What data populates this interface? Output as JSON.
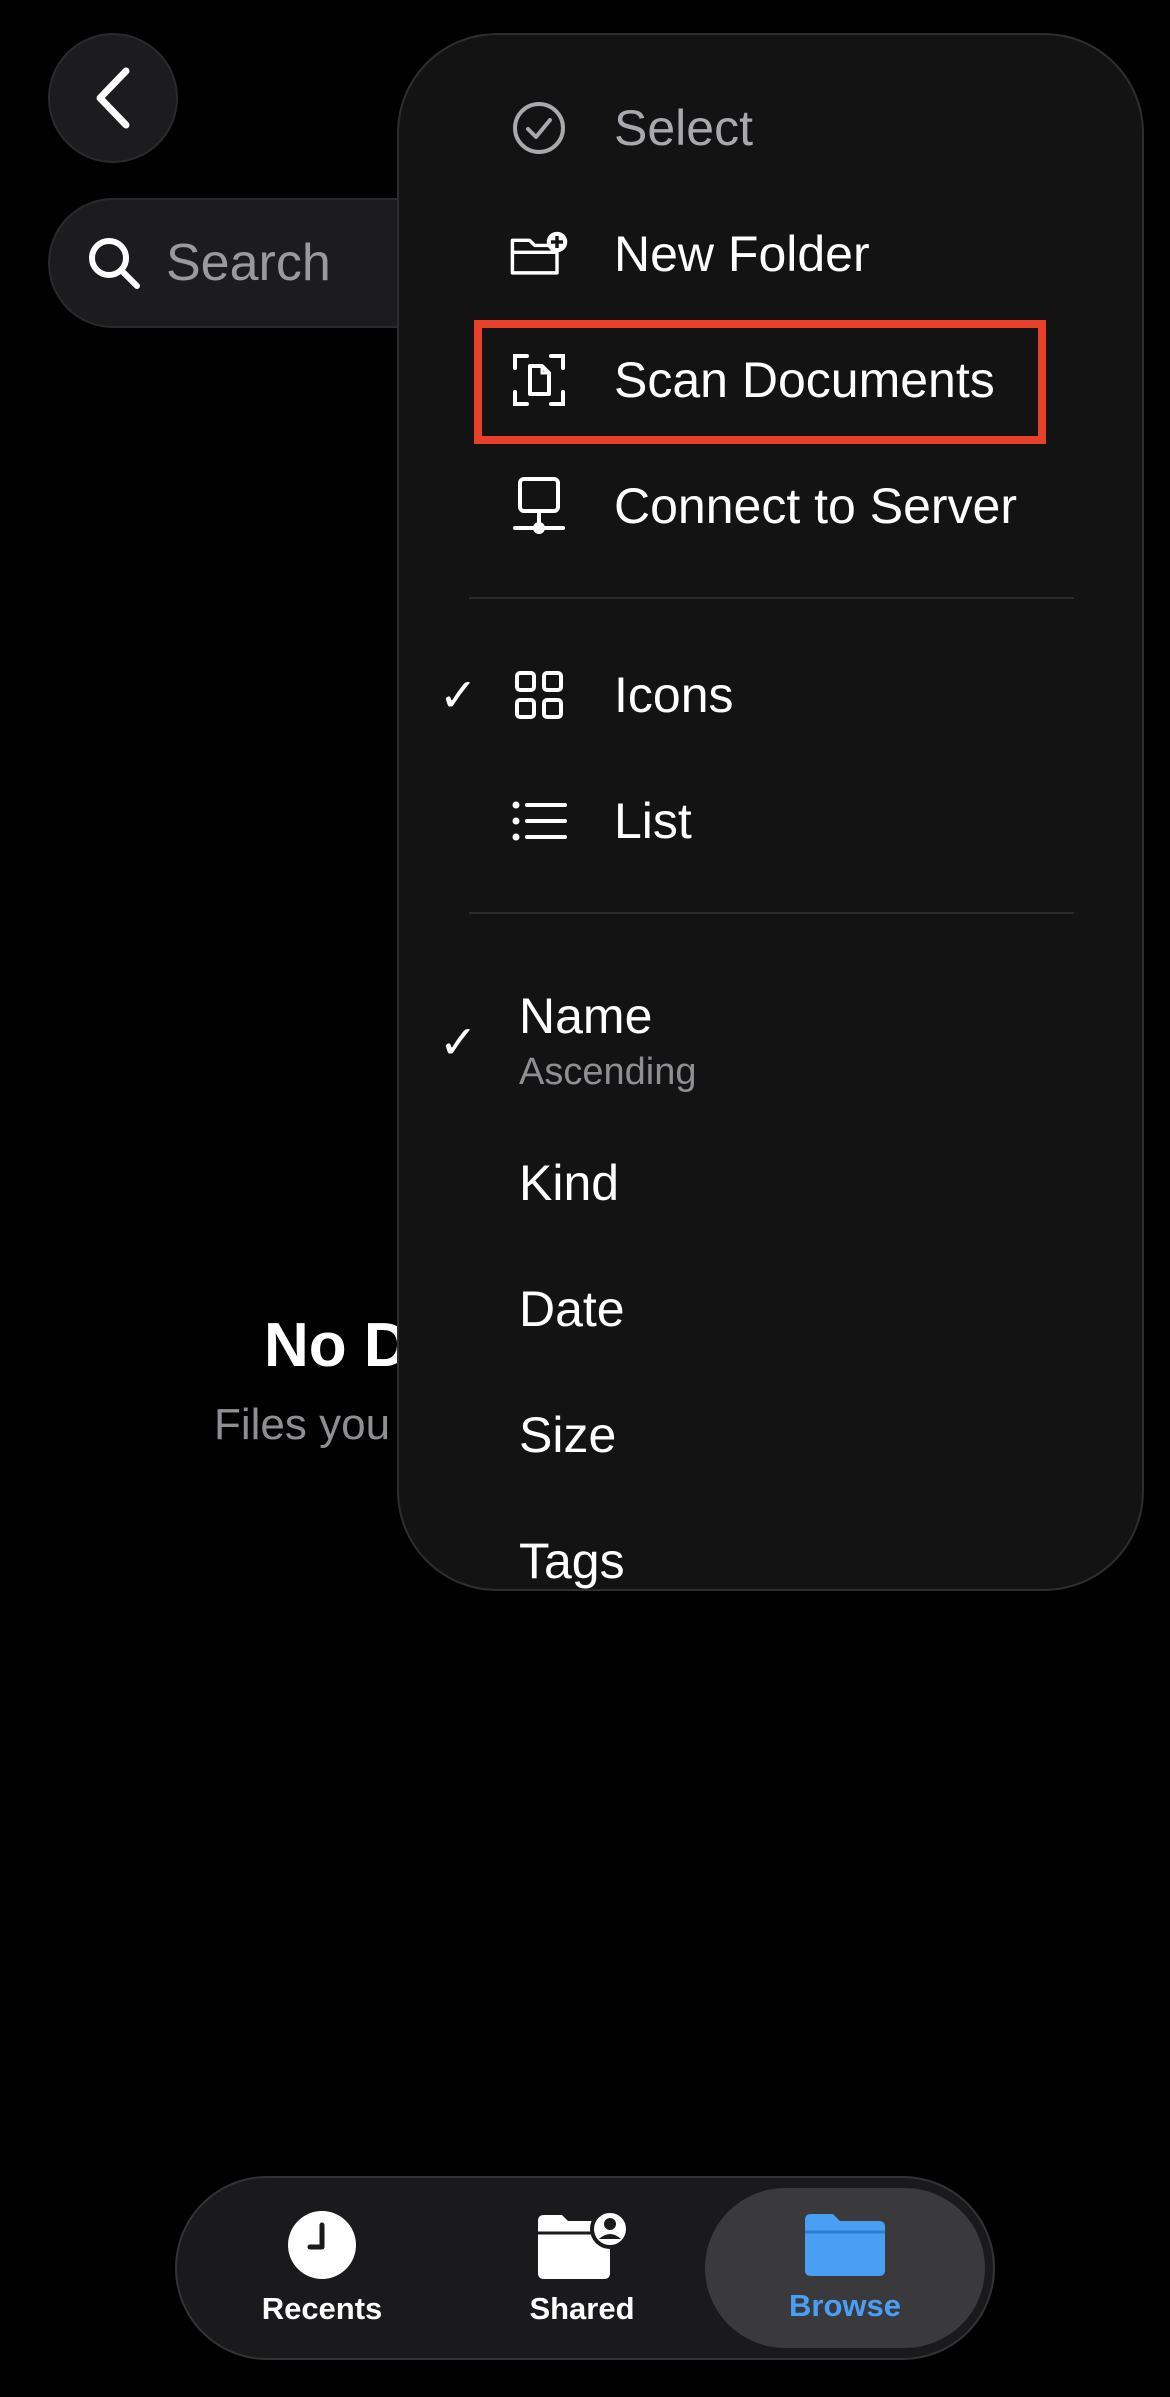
{
  "search": {
    "placeholder": "Search"
  },
  "empty_state": {
    "title": "No D",
    "subtitle": "Files you"
  },
  "menu": {
    "actions": [
      {
        "label": "Select"
      },
      {
        "label": "New Folder"
      },
      {
        "label": "Scan Documents",
        "highlighted": true
      },
      {
        "label": "Connect to Server"
      }
    ],
    "view_options": [
      {
        "label": "Icons",
        "checked": true
      },
      {
        "label": "List",
        "checked": false
      }
    ],
    "sort_options": [
      {
        "label": "Name",
        "sublabel": "Ascending",
        "checked": true
      },
      {
        "label": "Kind"
      },
      {
        "label": "Date"
      },
      {
        "label": "Size"
      },
      {
        "label": "Tags"
      }
    ]
  },
  "tabbar": {
    "tabs": [
      {
        "label": "Recents",
        "icon": "clock-icon"
      },
      {
        "label": "Shared",
        "icon": "shared-folder-icon"
      },
      {
        "label": "Browse",
        "icon": "folder-icon",
        "active": true
      }
    ]
  },
  "colors": {
    "accent": "#4a9ff5",
    "highlight": "#e8412b",
    "background": "#000000",
    "menu_bg": "#131313"
  },
  "check_glyph": "✓"
}
